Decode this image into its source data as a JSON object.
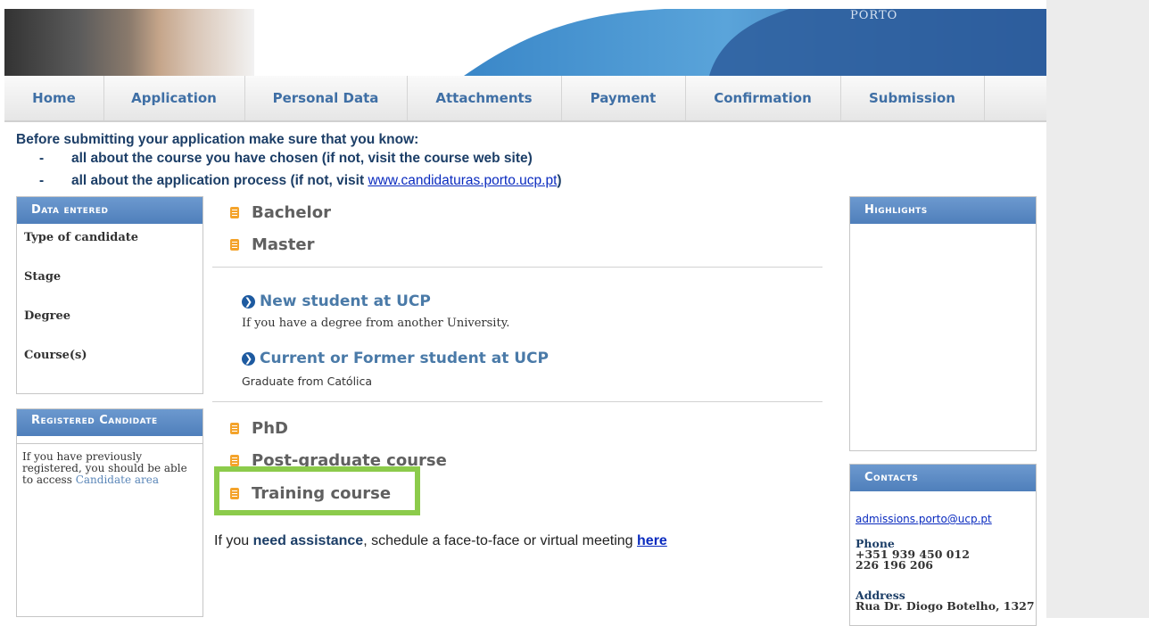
{
  "banner": {
    "logo_text": "PORTO"
  },
  "nav": [
    {
      "label": "Home"
    },
    {
      "label": "Application"
    },
    {
      "label": "Personal Data"
    },
    {
      "label": "Attachments"
    },
    {
      "label": "Payment"
    },
    {
      "label": "Confirmation"
    },
    {
      "label": "Submission"
    }
  ],
  "notice": {
    "intro": "Before submitting your application make sure that you know:",
    "bullet_dash": "-",
    "bullet1": "all about the course you have chosen (if not, visit the course web site)",
    "bullet2_prefix": "all about the application process (if not, visit ",
    "bullet2_link": "www.candidaturas.porto.ucp.pt",
    "bullet2_suffix": ")"
  },
  "data_entered": {
    "title": "Data entered",
    "labels": [
      "Type of candidate",
      "Stage",
      "Degree",
      "Course(s)"
    ]
  },
  "registered": {
    "title": "Registered Candidate",
    "text": "If you have previously registered, you should be able to access ",
    "link": "Candidate area"
  },
  "categories": {
    "bachelor": "Bachelor",
    "master": "Master",
    "phd": "PhD",
    "postgrad": "Post-graduate course",
    "training": "Training course"
  },
  "master_options": {
    "new_title": "New student at UCP",
    "new_desc": "If you have a degree from another University.",
    "current_title": "Current or Former student at UCP",
    "current_desc": "Graduate from Católica",
    "icon": "❯"
  },
  "assist": {
    "prefix": "If you ",
    "bold": "need assistance",
    "middle": ", schedule a face-to-face or virtual meeting ",
    "link": "here"
  },
  "highlights": {
    "title": "Highlights"
  },
  "contacts": {
    "title": "Contacts",
    "email": "admissions.porto@ucp.pt",
    "phone_label": "Phone",
    "phone1": "+351 939 450 012",
    "phone2": "226 196 206",
    "address_label": "Address",
    "address": "Rua Dr. Diogo Botelho, 1327"
  },
  "colors": {
    "accent": "#4f7fbb",
    "highlight_border": "#8ccb4b",
    "bullet": "#f4a32b"
  }
}
